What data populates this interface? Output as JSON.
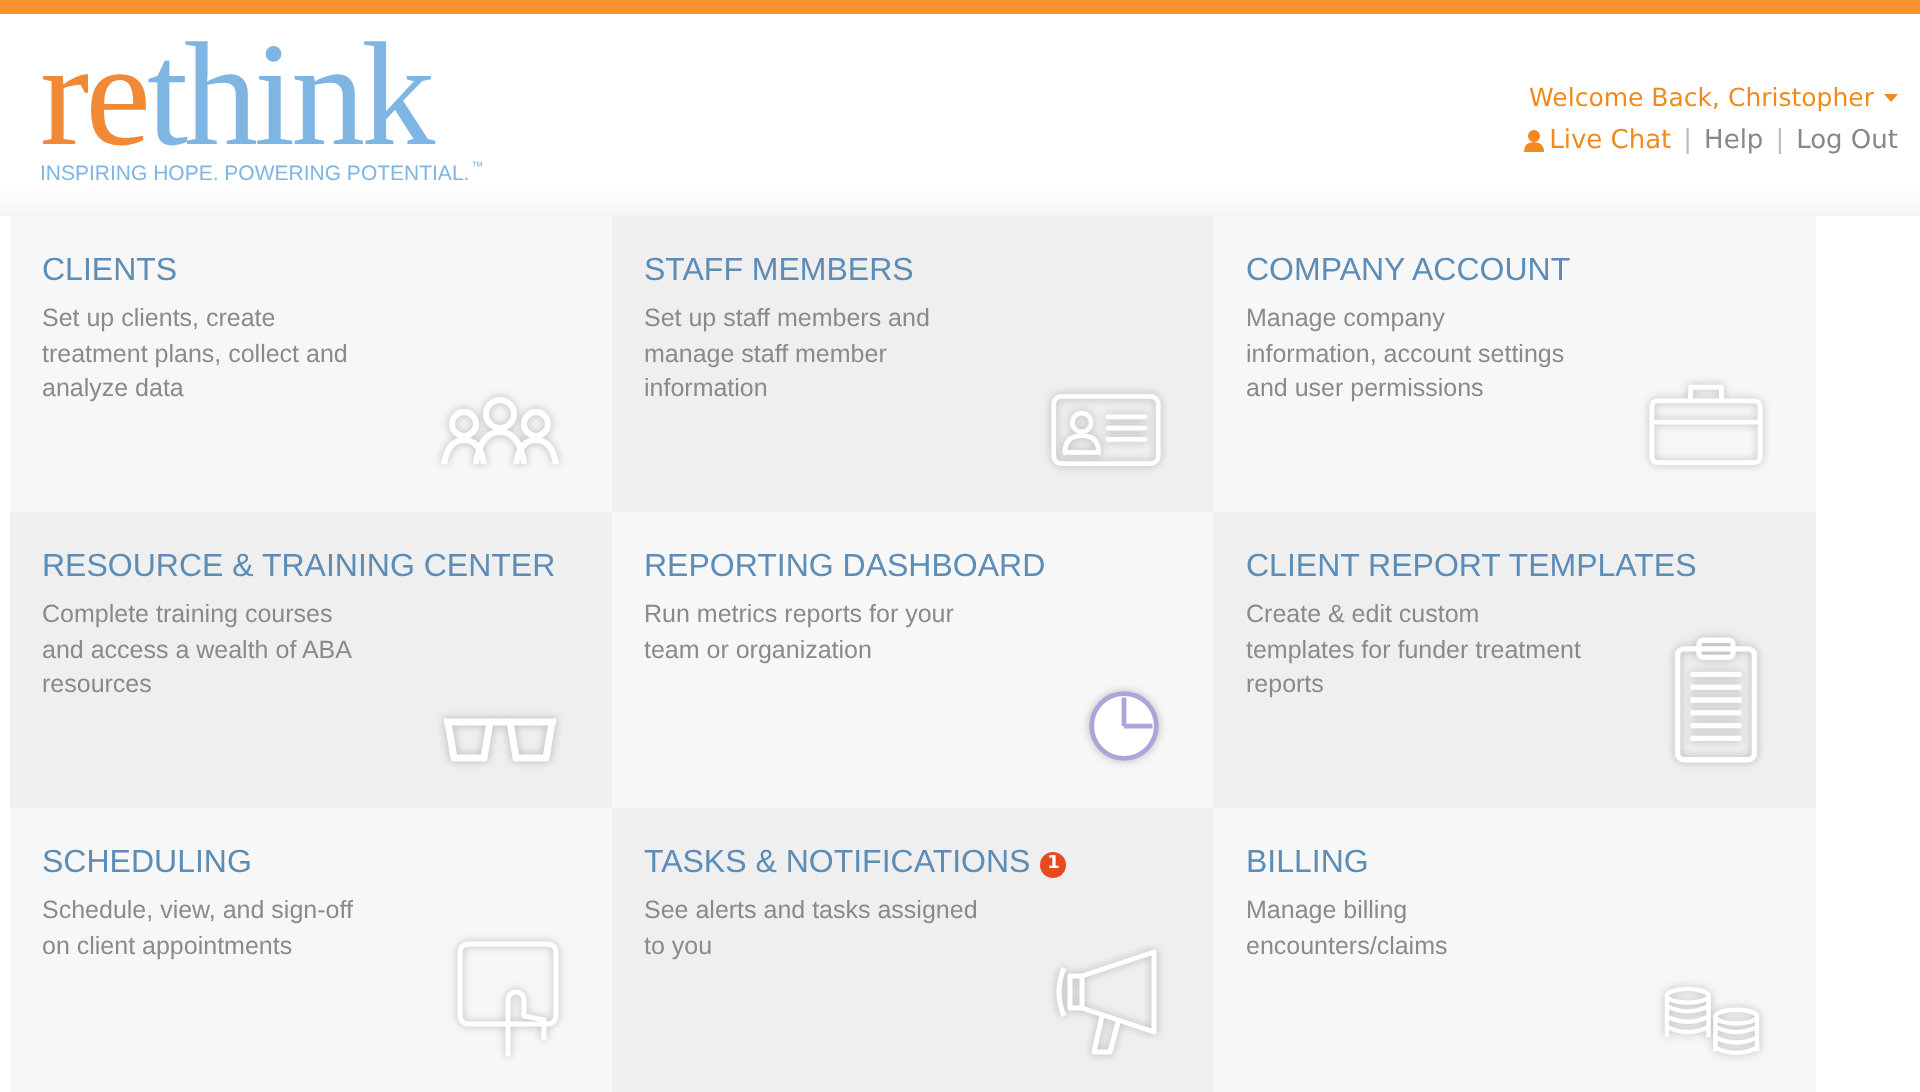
{
  "header": {
    "logo": {
      "part_1": "re",
      "part_2": "think",
      "tagline": "INSPIRING HOPE. POWERING POTENTIAL.",
      "trademark": "™"
    },
    "user_menu": "Welcome Back, Christopher",
    "separator": "|",
    "links": [
      {
        "label": "Live Chat"
      },
      {
        "label": "Help"
      },
      {
        "label": "Log Out"
      }
    ]
  },
  "tiles": [
    {
      "title": "CLIENTS",
      "description": "Set up clients, create treatment plans, collect and analyze data"
    },
    {
      "title": "STAFF MEMBERS",
      "description": "Set up staff members and manage staff member information"
    },
    {
      "title": "COMPANY ACCOUNT",
      "description": "Manage company information, account settings and user permissions"
    },
    {
      "title": "RESOURCE & TRAINING CENTER",
      "description": "Complete training courses and access a wealth of ABA resources"
    },
    {
      "title": "REPORTING DASHBOARD",
      "description": "Run metrics reports for your team or organization"
    },
    {
      "title": "CLIENT REPORT TEMPLATES",
      "description": "Create & edit custom templates for funder treatment reports"
    },
    {
      "title": "SCHEDULING",
      "description": "Schedule, view, and sign-off on client appointments"
    },
    {
      "title": "TASKS & NOTIFICATIONS",
      "description": "See alerts and tasks assigned to you",
      "badge": "1"
    },
    {
      "title": "BILLING",
      "description": "Manage billing encounters/claims"
    }
  ]
}
